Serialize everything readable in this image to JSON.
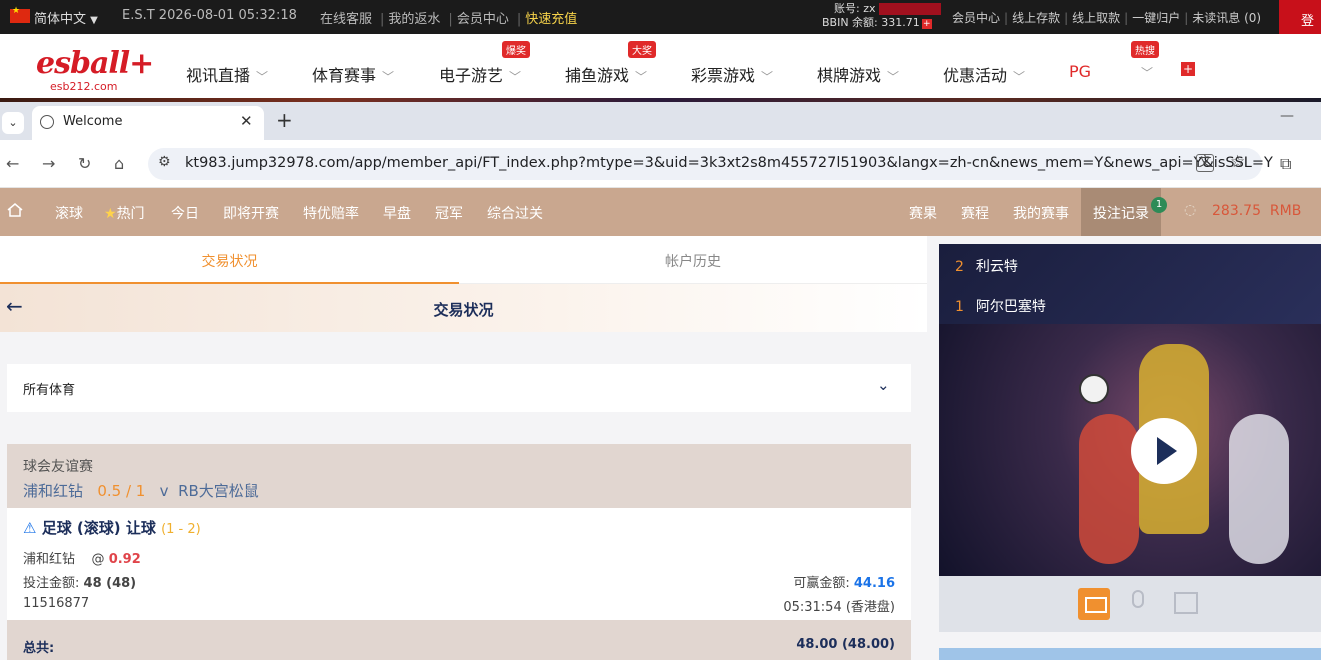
{
  "topbar": {
    "language": "简体中文",
    "clock": "E.S.T 2026-08-01 05:32:18",
    "links": [
      "在线客服",
      "我的返水",
      "会员中心"
    ],
    "recharge": "快速充值",
    "account_label": "账号: zx",
    "balance_label": "BBIN 余额:",
    "balance_value": "331.71",
    "right_links": [
      "会员中心",
      "线上存款",
      "线上取款",
      "一键归户",
      "未读讯息 (0)"
    ],
    "login": "登"
  },
  "nav": {
    "logo": "esball+",
    "logo_sub": "esb212.com",
    "items": [
      "视讯直播",
      "体育赛事",
      "电子游艺",
      "捕鱼游戏",
      "彩票游戏",
      "棋牌游戏",
      "优惠活动",
      "PG"
    ],
    "badges": {
      "slots": "爆奖",
      "fishing": "大奖",
      "hot": "热搜"
    }
  },
  "browser": {
    "tab_title": "Welcome",
    "url": "kt983.jump32978.com/app/member_api/FT_index.php?mtype=3&uid=3k3xt2s8m455727l51903&langx=zh-cn&news_mem=Y&news_api=Y&isSSL=Y"
  },
  "menu": {
    "left": [
      "滚球",
      "热门",
      "今日",
      "即将开赛",
      "特优赔率",
      "早盘",
      "冠军",
      "综合过关"
    ],
    "right": [
      "赛果",
      "赛程",
      "我的赛事"
    ],
    "bet_record": "投注记录",
    "bet_count": "1",
    "balance": "283.75",
    "currency": "RMB"
  },
  "main": {
    "tab_active": "交易状况",
    "tab_inactive": "帐户历史",
    "header_title": "交易状况",
    "filter": "所有体育",
    "bet": {
      "league": "球会友谊赛",
      "home": "浦和红钻",
      "handicap": "0.5 / 1",
      "vs": "v",
      "away": "RB大宫松鼠",
      "type": "足球 (滚球) 让球",
      "score": "(1 - 2)",
      "selection": "浦和红钻",
      "at": "@",
      "odds": "0.92",
      "stake_label": "投注金额:",
      "stake_value": "48 (48)",
      "win_label": "可赢金额:",
      "win_value": "44.16",
      "ticket": "11516877",
      "time": "05:31:54 (香港盘)",
      "total_label": "总共:",
      "total_value": "48.00 (48.00)"
    }
  },
  "side": {
    "rows": [
      {
        "rank": "2",
        "name": "利云特"
      },
      {
        "rank": "1",
        "name": "阿尔巴塞特"
      }
    ]
  },
  "colors": {
    "accent": "#f0902f",
    "menu_bg": "#c9a78f",
    "brand_red": "#d51c26"
  }
}
